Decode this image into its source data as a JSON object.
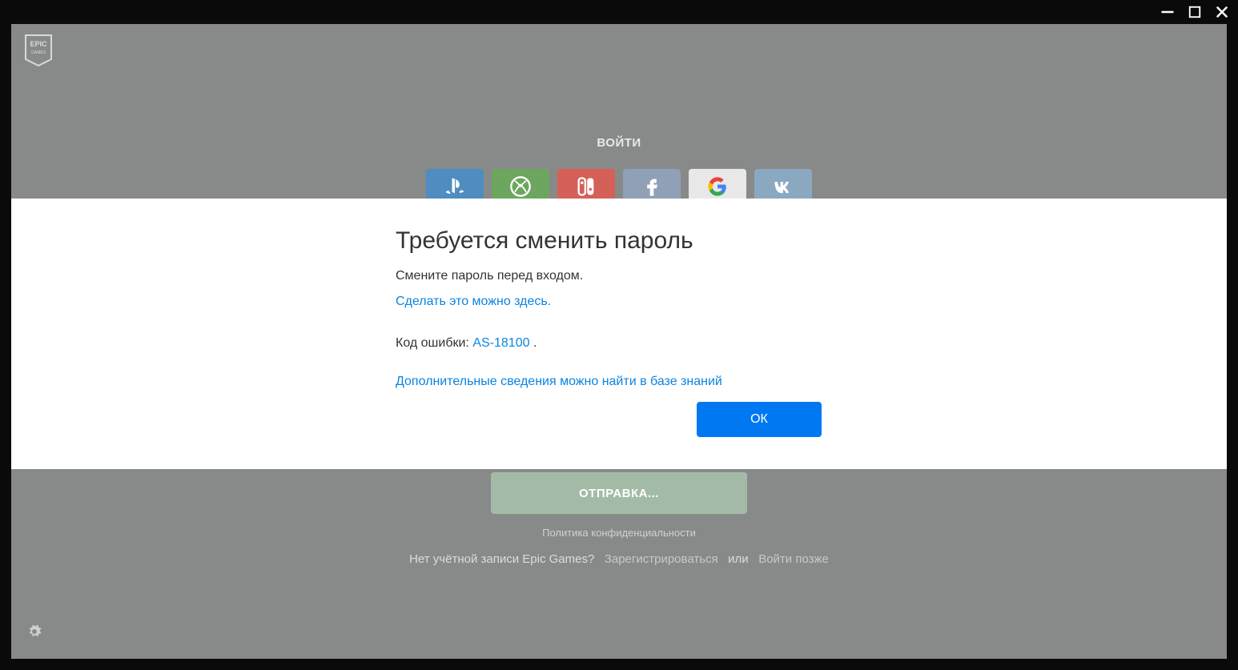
{
  "window": {
    "minimize": "—",
    "maximize": "▢",
    "close": "✕"
  },
  "brand": "EPIC GAMES",
  "login": {
    "title": "ВОЙТИ",
    "social": {
      "playstation": "playstation",
      "xbox": "xbox",
      "switch": "switch",
      "facebook": "facebook",
      "google": "google",
      "vk": "vk"
    },
    "submit_label": "ОТПРАВКА...",
    "privacy": "Политика конфиденциальности",
    "no_account": "Нет учётной записи Epic Games?",
    "register": "Зарегистрироваться",
    "or": "или",
    "login_later": "Войти позже"
  },
  "modal": {
    "title": "Требуется сменить пароль",
    "message": "Смените пароль перед входом.",
    "change_here_link": "Сделать это можно здесь.",
    "error_label": "Код ошибки:",
    "error_code": "AS-18100",
    "error_suffix": ".",
    "kb_link": "Дополнительные сведения можно найти в базе знаний",
    "ok": "ОК"
  }
}
